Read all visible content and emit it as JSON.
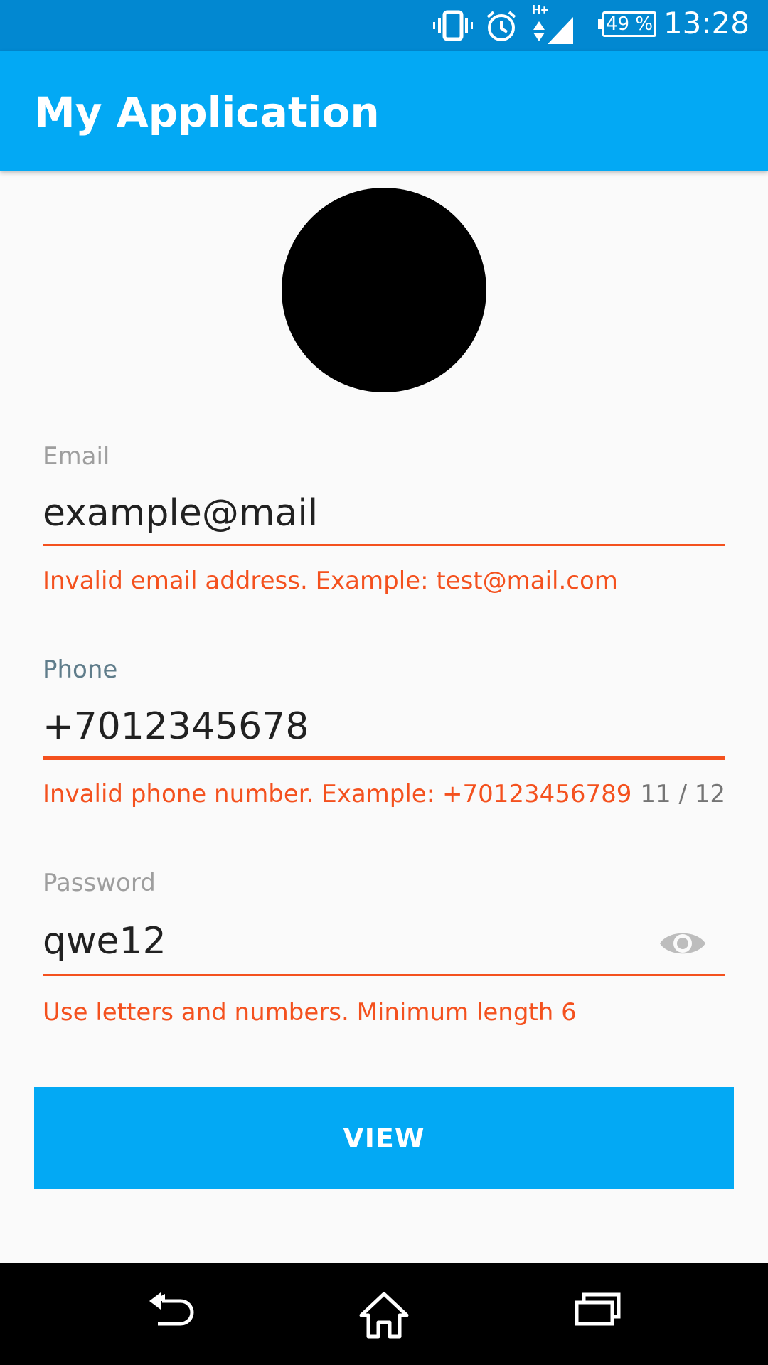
{
  "status_bar": {
    "time": "13:28",
    "battery": "49 %",
    "network": "H+",
    "icons": [
      "vibrate-icon",
      "alarm-icon",
      "signal-icon",
      "battery-icon"
    ]
  },
  "app_bar": {
    "title": "My Application"
  },
  "form": {
    "email": {
      "label": "Email",
      "value": "example@mail",
      "error": "Invalid email address. Example: test@mail.com"
    },
    "phone": {
      "label": "Phone",
      "value": "+7012345678",
      "error": "Invalid phone number. Example: +70123456789",
      "counter": "11 / 12"
    },
    "password": {
      "label": "Password",
      "value": "qwe12",
      "error": "Use letters and numbers. Minimum length 6",
      "toggle_icon": "eye-icon"
    },
    "button_label": "VIEW"
  },
  "nav_bar": {
    "icons": [
      "back-icon",
      "home-icon",
      "recents-icon"
    ]
  },
  "colors": {
    "status_bar": "#0288d1",
    "app_bar": "#03a9f4",
    "error": "#f4511e",
    "button": "#03a9f4"
  }
}
